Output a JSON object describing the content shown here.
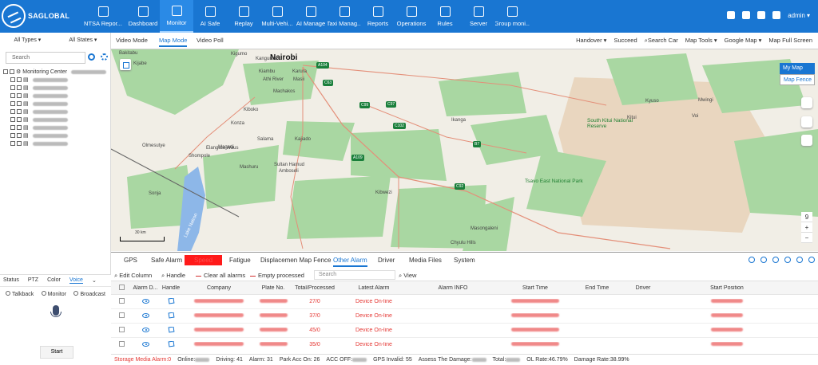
{
  "brand": {
    "name": "SAGLOBAL"
  },
  "nav": [
    {
      "label": "NTSA Repor...",
      "icon": "report-chart-icon"
    },
    {
      "label": "Dashboard",
      "icon": "dashboard-icon"
    },
    {
      "label": "Monitor",
      "icon": "location-pin-icon",
      "active": true
    },
    {
      "label": "AI Safe",
      "icon": "shield-icon"
    },
    {
      "label": "Replay",
      "icon": "replay-icon"
    },
    {
      "label": "Multi-Vehi...",
      "icon": "multi-vehicle-icon"
    },
    {
      "label": "AI Manage",
      "icon": "ai-manage-icon"
    },
    {
      "label": "Taxi Manag...",
      "icon": "taxi-icon"
    },
    {
      "label": "Reports",
      "icon": "report-icon"
    },
    {
      "label": "Operations",
      "icon": "operations-icon"
    },
    {
      "label": "Rules",
      "icon": "rules-icon"
    },
    {
      "label": "Server",
      "icon": "server-icon"
    },
    {
      "label": "Group moni...",
      "icon": "group-monitor-icon"
    }
  ],
  "user": {
    "name": "admin"
  },
  "left": {
    "types": "All Types",
    "states": "All States",
    "search_placeholder": "Search",
    "root": "Monitoring Center",
    "children_count": 9
  },
  "voice": {
    "tabs": [
      "Status",
      "PTZ",
      "Color",
      "Voice"
    ],
    "active_tab": "Voice",
    "modes": [
      "Talkback",
      "Monitor",
      "Broadcast"
    ],
    "start": "Start"
  },
  "map_header": {
    "tabs": [
      "Video Mode",
      "Map Mode",
      "Video Poll"
    ],
    "active": "Map Mode",
    "tools": [
      "Handover",
      "Succeed",
      "Search Car",
      "Map Tools",
      "Google Map",
      "Map Full Screen"
    ]
  },
  "map": {
    "labels": [
      "Nairobi",
      "Bakitabu",
      "Kijabe",
      "Kigumo",
      "Kangundo",
      "Kiambu",
      "Karura",
      "Athi River",
      "Masii",
      "Machakos",
      "Kiboko",
      "Magadi",
      "Konza",
      "Kajiado",
      "Salama",
      "Olmesutye",
      "Elangata Waus",
      "Kibwezi",
      "Mashuru",
      "Sultan Hamud",
      "Shompole",
      "Sonja",
      "Lake Natron",
      "Amboseli",
      "Tsavo East National Park",
      "South Kitui National Reserve",
      "Chyulu Hills",
      "Kitui",
      "Kyuso",
      "Mwingi",
      "Ikanga",
      "Masongaleni",
      "Voi"
    ],
    "my_map": "My Map",
    "map_fence": "Map Fence",
    "scale": "30 km"
  },
  "alert_tabs": [
    "GPS",
    "Safe Alarm",
    "Speed",
    "Fatigue",
    "Displacemen Map Fence",
    "Other Alarm",
    "Driver",
    "Media Files",
    "System"
  ],
  "active_alert_tab": "Other Alarm",
  "table_actions": {
    "edit": "Edit Column",
    "handle": "Handle",
    "clear": "Clear all alarms",
    "empty": "Empty processed",
    "search": "Search",
    "view": "View"
  },
  "columns": [
    "Alarm D...",
    "Handle",
    "Company",
    "Plate No.",
    "Total/Processed",
    "Latest Alarm",
    "Alarm INFO",
    "Start Time",
    "End Time",
    "Driver",
    "Start Position"
  ],
  "rows": [
    {
      "total": "27/0",
      "alarm": "Device On-line"
    },
    {
      "total": "37/0",
      "alarm": "Device On-line"
    },
    {
      "total": "45/0",
      "alarm": "Device On-line"
    },
    {
      "total": "35/0",
      "alarm": "Device On-line"
    }
  ],
  "footer": {
    "storage": "Storage Media Alarm:0",
    "online": "Online:",
    "driving": "Driving: 41",
    "alarm": "Alarm: 31",
    "park": "Park Acc On: 26",
    "acc": "ACC OFF:",
    "gps": "GPS Invalid: 55",
    "assess": "Assess The Damage:",
    "total": "Total:",
    "ol_rate": "OL Rate:46.79%",
    "damage": "Damage Rate:38.99%"
  },
  "colors": {
    "primary": "#1976d2",
    "alert": "#e53935",
    "map_green": "#a9d7a2",
    "water": "#8db7e8"
  }
}
